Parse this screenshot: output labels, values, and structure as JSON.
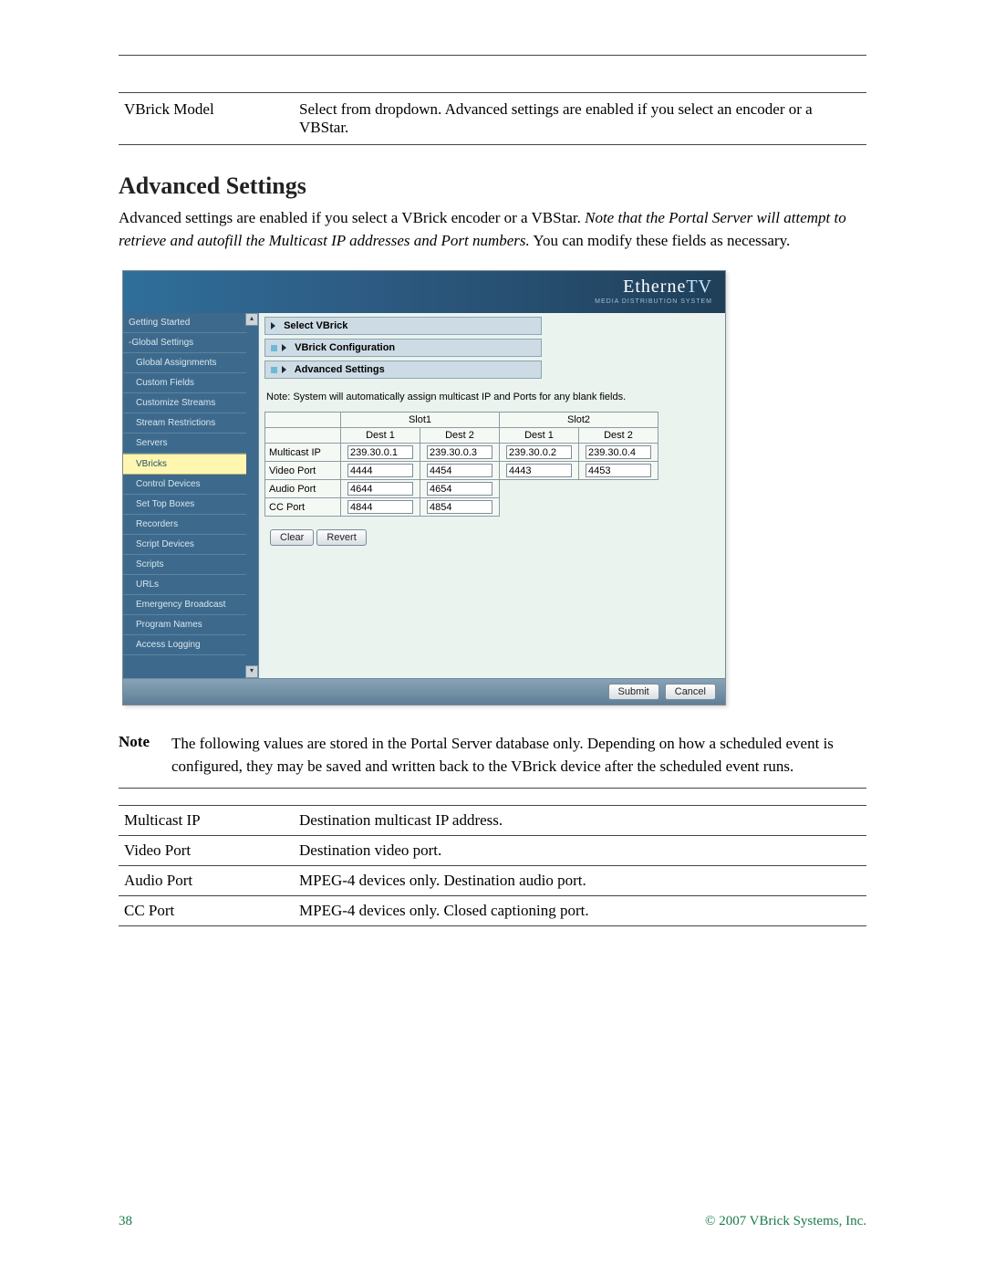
{
  "table1": {
    "label": "VBrick Model",
    "desc": "Select from dropdown. Advanced settings are enabled if you select an encoder or a VBStar."
  },
  "section_heading": "Advanced Settings",
  "para": {
    "lead": "Advanced settings are enabled if you select a VBrick encoder or a VBStar. ",
    "italic": "Note that the Portal Server will attempt to retrieve and autofill the Multicast IP addresses and Port numbers.",
    "tail": " You can modify these fields as necessary."
  },
  "screenshot": {
    "brand1": "Etherne",
    "brand2": "TV",
    "subbrand": "MEDIA DISTRIBUTION SYSTEM",
    "sidebar": [
      {
        "label": "Getting Started",
        "indent": false
      },
      {
        "label": "-Global Settings",
        "indent": false
      },
      {
        "label": "Global Assignments",
        "indent": true
      },
      {
        "label": "Custom Fields",
        "indent": true
      },
      {
        "label": "Customize Streams",
        "indent": true
      },
      {
        "label": "Stream Restrictions",
        "indent": true
      },
      {
        "label": "Servers",
        "indent": true
      },
      {
        "label": "VBricks",
        "indent": true,
        "selected": true
      },
      {
        "label": "Control Devices",
        "indent": true
      },
      {
        "label": "Set Top Boxes",
        "indent": true
      },
      {
        "label": "Recorders",
        "indent": true
      },
      {
        "label": "Script Devices",
        "indent": true
      },
      {
        "label": "Scripts",
        "indent": true
      },
      {
        "label": "URLs",
        "indent": true
      },
      {
        "label": "Emergency Broadcast",
        "indent": true
      },
      {
        "label": "Program Names",
        "indent": true
      },
      {
        "label": "Access Logging",
        "indent": true
      }
    ],
    "accordion": [
      "Select VBrick",
      "VBrick Configuration",
      "Advanced Settings"
    ],
    "note": "Note: System will automatically assign multicast IP and Ports for any blank fields.",
    "cols_top": [
      "Slot1",
      "Slot2"
    ],
    "cols_sub": [
      "Dest 1",
      "Dest 2",
      "Dest 1",
      "Dest 2"
    ],
    "rows": [
      {
        "h": "Multicast IP",
        "v": [
          "239.30.0.1",
          "239.30.0.3",
          "239.30.0.2",
          "239.30.0.4"
        ]
      },
      {
        "h": "Video Port",
        "v": [
          "4444",
          "4454",
          "4443",
          "4453"
        ]
      },
      {
        "h": "Audio Port",
        "v": [
          "4644",
          "4654",
          "",
          ""
        ],
        "cols": 2
      },
      {
        "h": "CC Port",
        "v": [
          "4844",
          "4854",
          "",
          ""
        ],
        "cols": 2
      }
    ],
    "buttons": {
      "clear": "Clear",
      "revert": "Revert"
    },
    "footer": {
      "submit": "Submit",
      "cancel": "Cancel"
    }
  },
  "note_block": {
    "label": "Note",
    "text": "The following values are stored in the Portal Server database only. Depending on how a scheduled event is configured, they may be saved and written back to the VBrick device after the scheduled event runs."
  },
  "table2": [
    {
      "k": "Multicast IP",
      "v": "Destination multicast IP address."
    },
    {
      "k": "Video Port",
      "v": "Destination video port."
    },
    {
      "k": "Audio Port",
      "v": "MPEG-4 devices only. Destination audio port."
    },
    {
      "k": "CC Port",
      "v": "MPEG-4 devices only. Closed captioning port."
    }
  ],
  "footer": {
    "page": "38",
    "copy": "© 2007 VBrick Systems, Inc."
  }
}
